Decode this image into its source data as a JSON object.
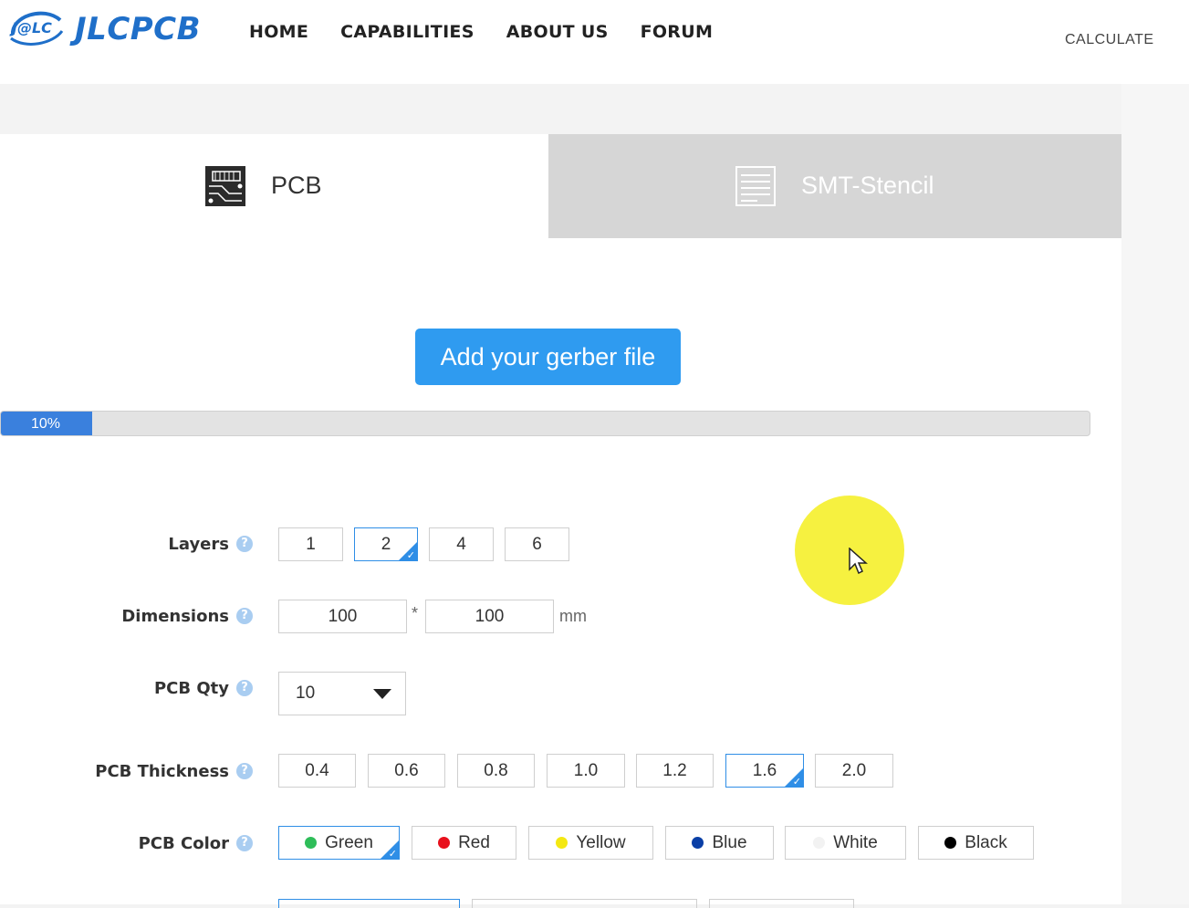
{
  "header": {
    "logo_badge": "J@LC",
    "logo_text": "JLCPCB",
    "nav": [
      "HOME",
      "CAPABILITIES",
      "ABOUT US",
      "FORUM"
    ],
    "calculate": "CALCULATE"
  },
  "tabs": [
    {
      "label": "PCB",
      "icon": "pcb-board-icon",
      "active": true
    },
    {
      "label": "SMT-Stencil",
      "icon": "stencil-icon",
      "active": false
    }
  ],
  "upload_button": "Add your gerber file",
  "progress": {
    "percent": 10,
    "label": "10%"
  },
  "form": {
    "layers": {
      "label": "Layers",
      "options": [
        "1",
        "2",
        "4",
        "6"
      ],
      "selected": "2"
    },
    "dimensions": {
      "label": "Dimensions",
      "width": "100",
      "separator": "*",
      "height": "100",
      "unit": "mm"
    },
    "qty": {
      "label": "PCB Qty",
      "value": "10"
    },
    "thickness": {
      "label": "PCB Thickness",
      "options": [
        "0.4",
        "0.6",
        "0.8",
        "1.0",
        "1.2",
        "1.6",
        "2.0"
      ],
      "selected": "1.6"
    },
    "color": {
      "label": "PCB Color",
      "options": [
        {
          "name": "Green",
          "swatch": "#2ebd59"
        },
        {
          "name": "Red",
          "swatch": "#e8101c"
        },
        {
          "name": "Yellow",
          "swatch": "#f4e812"
        },
        {
          "name": "Blue",
          "swatch": "#0a3fa6"
        },
        {
          "name": "White",
          "swatch": "#f2f2f2"
        },
        {
          "name": "Black",
          "swatch": "#000000"
        }
      ],
      "selected": "Green"
    },
    "help_glyph": "?"
  },
  "colors": {
    "accent": "#2f9bf0",
    "brand": "#1f6fc9",
    "tab_inactive": "#d6d6d6"
  }
}
